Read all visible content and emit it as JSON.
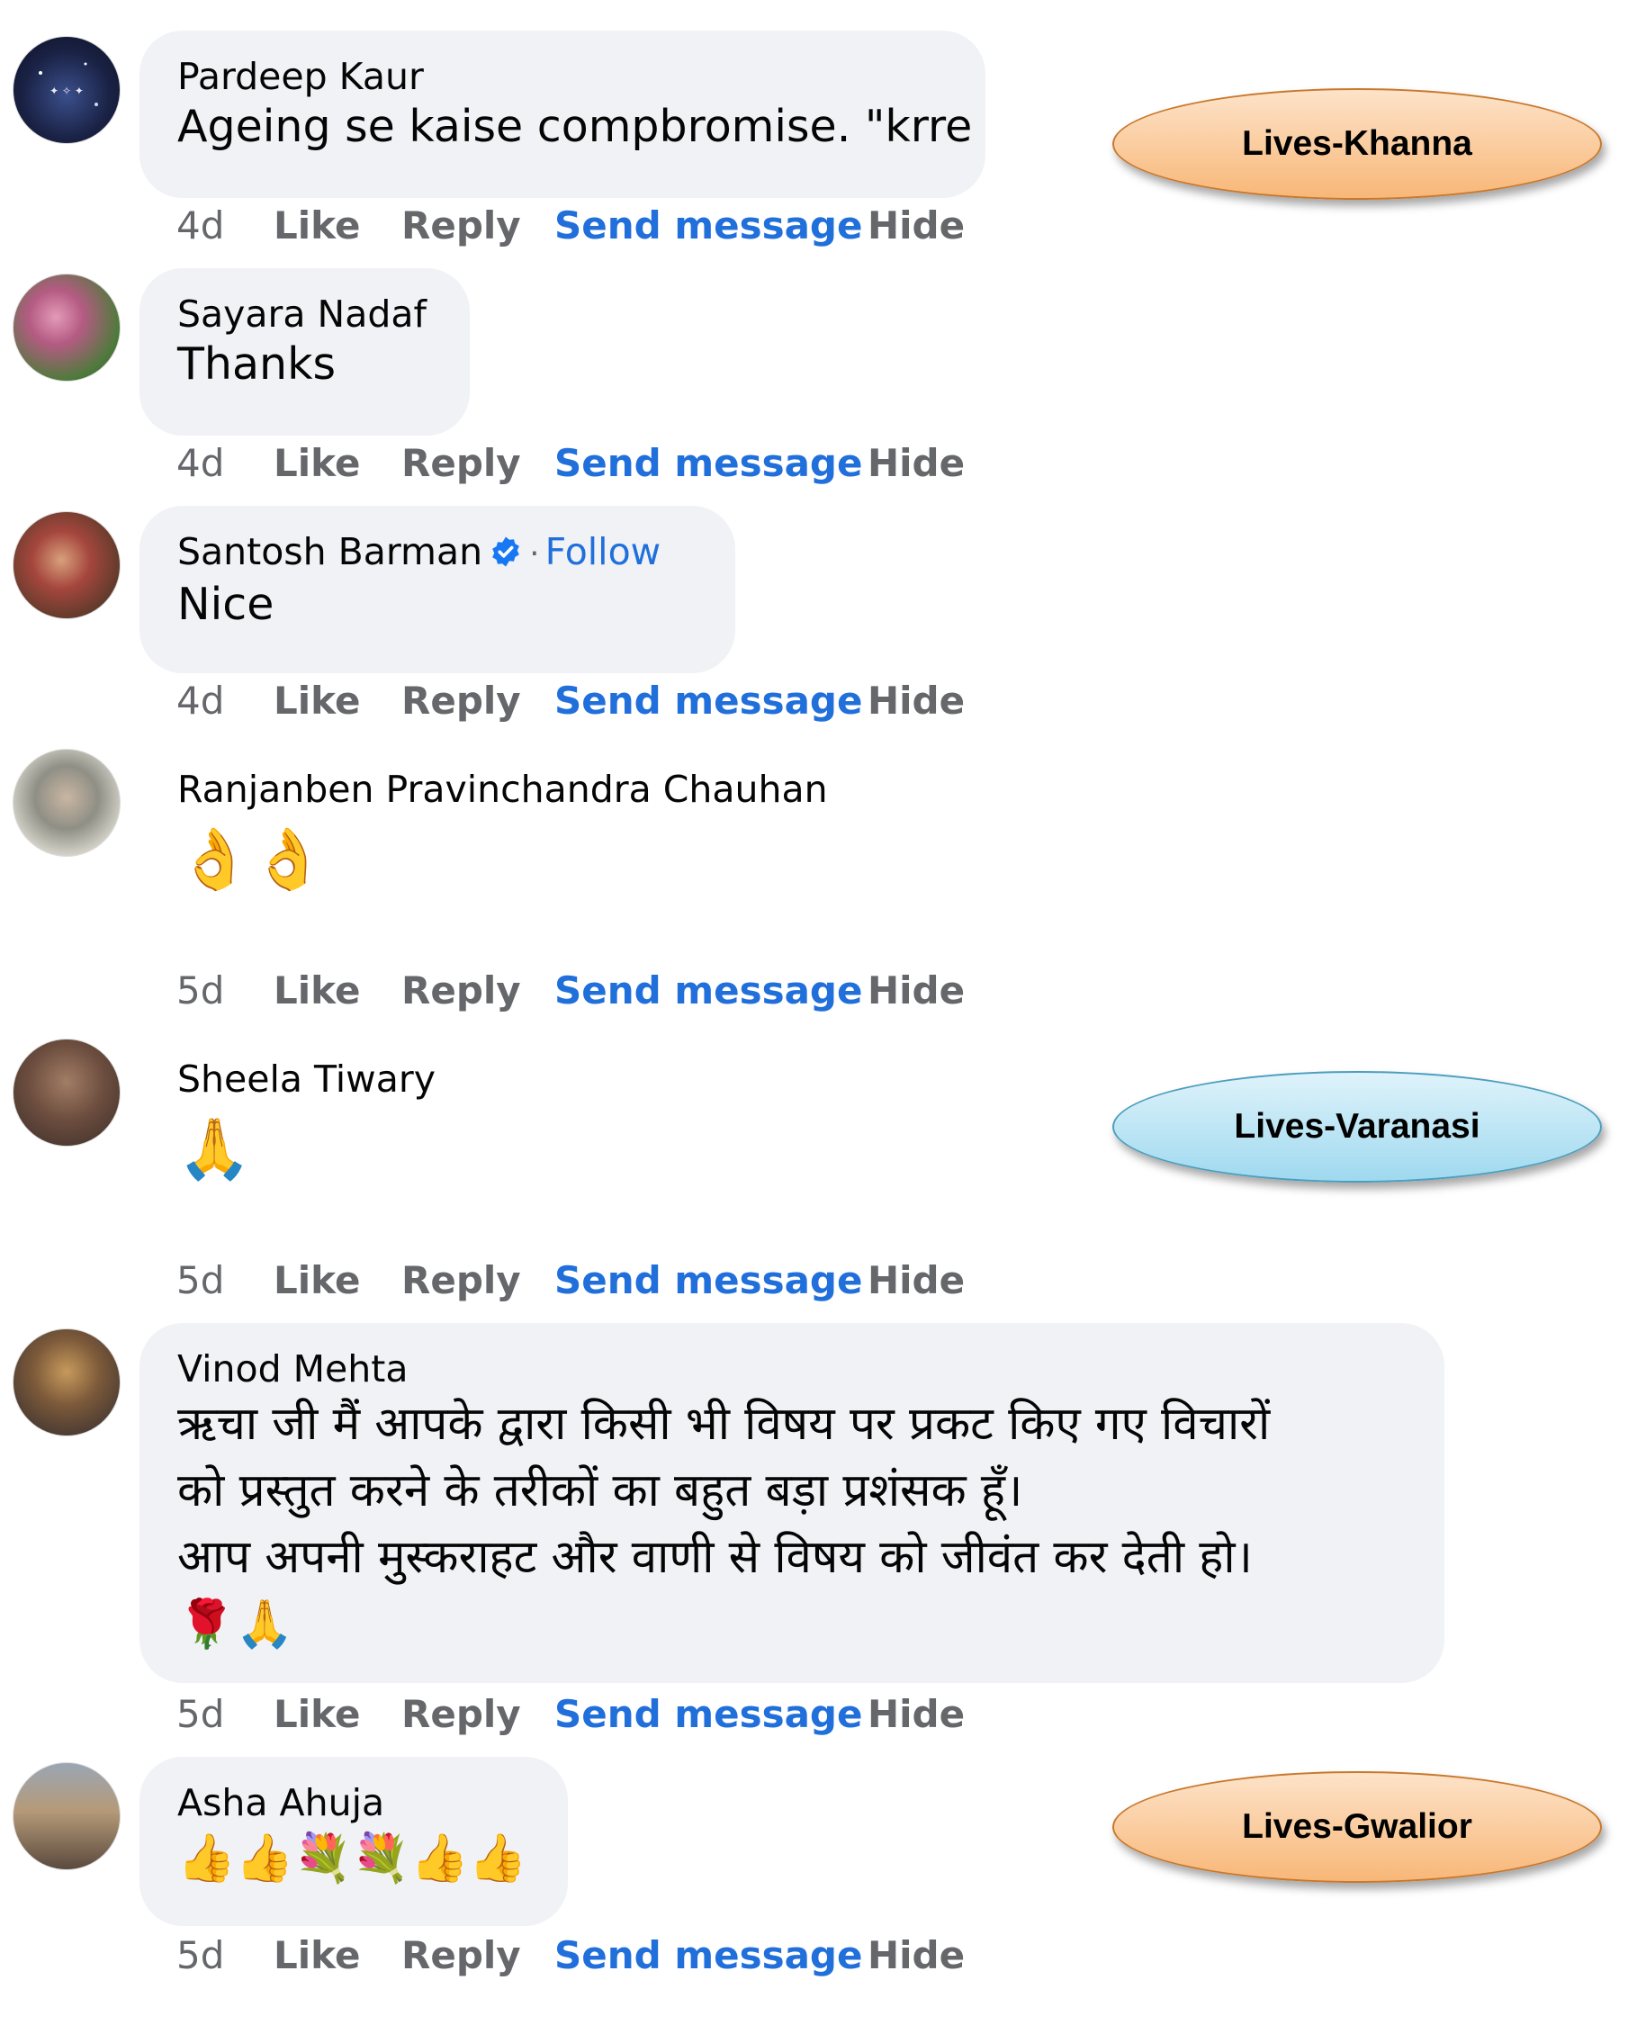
{
  "colors": {
    "link": "#216fdb",
    "meta": "#65676b",
    "bubble": "#f0f2f5",
    "verified": "#1877f2"
  },
  "action_labels": {
    "like": "Like",
    "reply": "Reply",
    "send": "Send message",
    "hide": "Hide"
  },
  "comments": [
    {
      "author": "Pardeep Kaur",
      "text": "Ageing se kaise compbromise. \"krre",
      "time": "4d"
    },
    {
      "author": "Sayara Nadaf",
      "text": "Thanks",
      "time": "4d"
    },
    {
      "author": "Santosh Barman",
      "follow": "Follow",
      "text": "Nice",
      "time": "4d",
      "verified": true
    },
    {
      "author": "Ranjanben Pravinchandra Chauhan",
      "text": "👌👌",
      "time": "5d"
    },
    {
      "author": "Sheela Tiwary",
      "text": "🙏",
      "time": "5d"
    },
    {
      "author": "Vinod Mehta",
      "lines": [
        "ऋचा जी मैं आपके द्वारा किसी भी विषय पर प्रकट किए गए विचारों",
        "को प्रस्तुत करने के तरीकों का बहुत बड़ा प्रशंसक हूँ।",
        "आप अपनी मुस्कराहट और वाणी से विषय को जीवंत कर देती हो।"
      ],
      "emoji": "🌹🙏",
      "time": "5d"
    },
    {
      "author": "Asha Ahuja",
      "text": "👍👍💐💐👍👍",
      "time": "5d"
    }
  ],
  "tags": [
    {
      "label": "Lives-Khanna",
      "color": "orange"
    },
    {
      "label": "Lives-Varanasi",
      "color": "blue"
    },
    {
      "label": "Lives-Gwalior",
      "color": "orange"
    }
  ]
}
